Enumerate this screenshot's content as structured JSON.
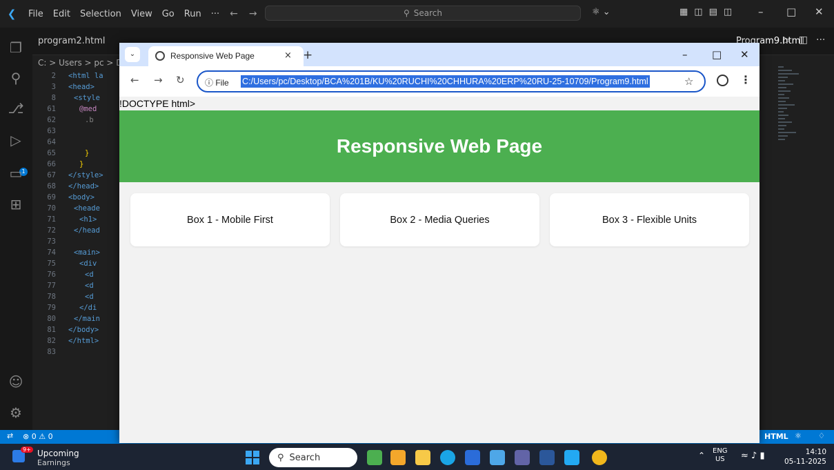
{
  "vscode": {
    "menu": [
      "File",
      "Edit",
      "Selection",
      "View",
      "Go",
      "Run",
      "···"
    ],
    "search_placeholder": "Search",
    "tabs": {
      "program2": "program2.html",
      "program9": "Program9.html"
    },
    "breadcrumb": "C: > Users > pc > D",
    "code_lines": [
      {
        "ln": "2",
        "text": "<html la"
      },
      {
        "ln": "3",
        "text": "<head>"
      },
      {
        "ln": "8",
        "text": "<style"
      },
      {
        "ln": "61",
        "text": "@med"
      },
      {
        "ln": "62",
        "text": ".b"
      },
      {
        "ln": "63",
        "text": ""
      },
      {
        "ln": "64",
        "text": ""
      },
      {
        "ln": "65",
        "text": "}"
      },
      {
        "ln": "66",
        "text": "}"
      },
      {
        "ln": "67",
        "text": "</style>"
      },
      {
        "ln": "68",
        "text": "</head>"
      },
      {
        "ln": "69",
        "text": "<body>"
      },
      {
        "ln": "70",
        "text": "<heade"
      },
      {
        "ln": "71",
        "text": "<h1>"
      },
      {
        "ln": "72",
        "text": "</head"
      },
      {
        "ln": "73",
        "text": ""
      },
      {
        "ln": "74",
        "text": "<main>"
      },
      {
        "ln": "75",
        "text": "<div"
      },
      {
        "ln": "76",
        "text": "<d"
      },
      {
        "ln": "77",
        "text": "<d"
      },
      {
        "ln": "78",
        "text": "<d"
      },
      {
        "ln": "79",
        "text": "</di"
      },
      {
        "ln": "80",
        "text": "</main"
      },
      {
        "ln": "81",
        "text": "</body>"
      },
      {
        "ln": "82",
        "text": "</html>"
      },
      {
        "ln": "83",
        "text": ""
      }
    ],
    "activity_badge": "1",
    "statusbar": {
      "problems": "⊗ 0 ⚠ 0",
      "language": "HTML"
    }
  },
  "chrome": {
    "tab_title": "Responsive Web Page",
    "tab_close": "×",
    "new_tab": "+",
    "address_info": "ⓘ File",
    "address_url": "C:/Users/pc/Desktop/BCA%201B/KU%20RUCHI%20CHHURA%20ERP%20RU-25-10709/Program9.html"
  },
  "page": {
    "doctype_text": "!DOCTYPE html>",
    "header_title": "Responsive Web Page",
    "boxes": [
      "Box 1 - Mobile First",
      "Box 2 - Media Queries",
      "Box 3 - Flexible Units"
    ]
  },
  "taskbar": {
    "weather_badge": "9+",
    "weather_title": "Upcoming",
    "weather_sub": "Earnings",
    "search_placeholder": "Search",
    "lang_top": "ENG",
    "lang_bottom": "US",
    "time": "14:10",
    "date": "05-11-2025"
  },
  "colors": {
    "header_green": "#4caf50",
    "vscode_blue": "#0078d4",
    "url_highlight": "#2f6fe0"
  }
}
